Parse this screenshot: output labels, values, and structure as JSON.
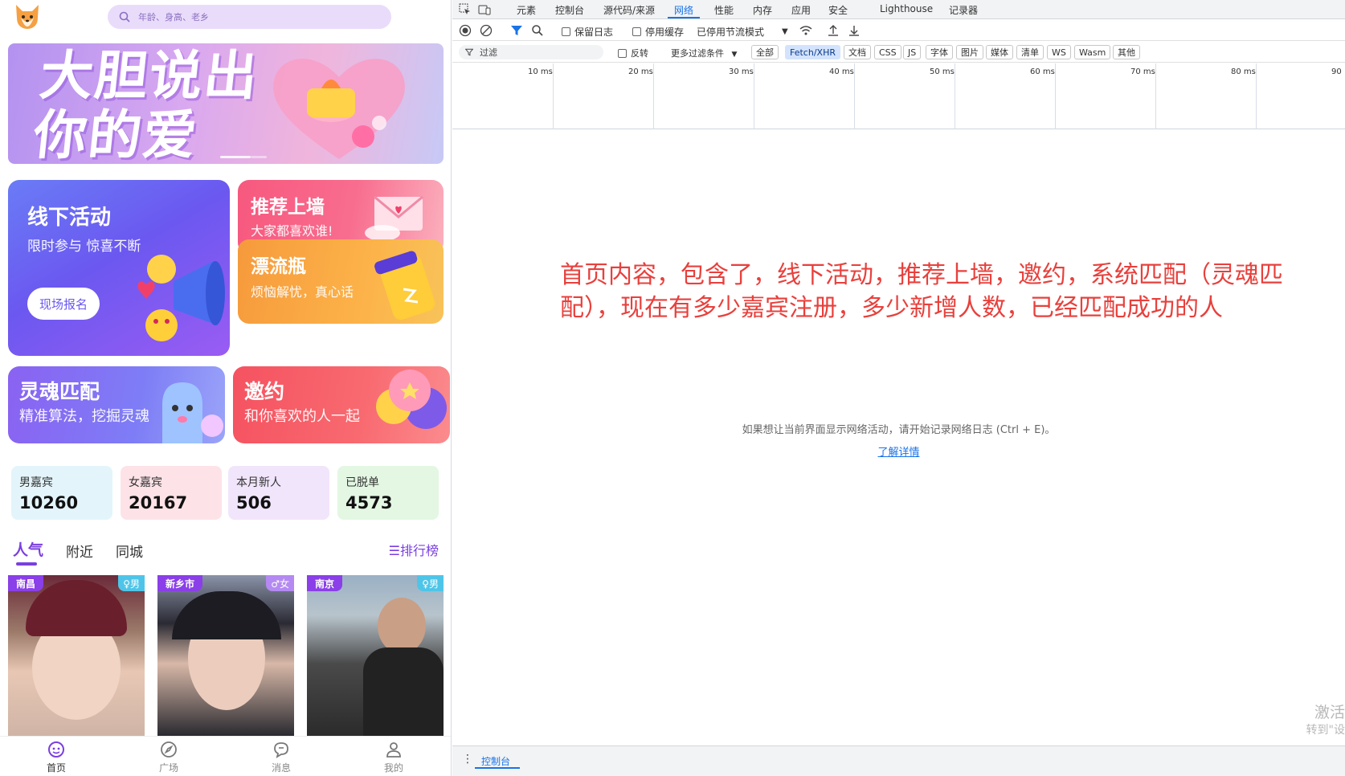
{
  "app": {
    "search_placeholder": "年龄、身高、老乡",
    "banner": {
      "line1": "大胆说出",
      "line2": "你的爱"
    },
    "cards": {
      "offline": {
        "title": "线下活动",
        "subtitle": "限时参与 惊喜不断",
        "button": "现场报名"
      },
      "recommend": {
        "title": "推荐上墙",
        "subtitle": "大家都喜欢谁!"
      },
      "bottle": {
        "title": "漂流瓶",
        "subtitle": "烦恼解忧，真心话"
      },
      "soul": {
        "title": "灵魂匹配",
        "subtitle": "精准算法，挖掘灵魂"
      },
      "invite": {
        "title": "邀约",
        "subtitle": "和你喜欢的人一起"
      }
    },
    "stats": [
      {
        "label": "男嘉宾",
        "value": "10260"
      },
      {
        "label": "女嘉宾",
        "value": "20167"
      },
      {
        "label": "本月新人",
        "value": "506"
      },
      {
        "label": "已脱单",
        "value": "4573"
      }
    ],
    "tabs": [
      "人气",
      "附近",
      "同城"
    ],
    "active_tab": "人气",
    "ranking": "☰排行榜",
    "profiles": [
      {
        "city": "南昌",
        "gender": "♀男"
      },
      {
        "city": "新乡市",
        "gender": "♂女"
      },
      {
        "city": "南京",
        "gender": "♀男"
      }
    ],
    "nav": [
      {
        "label": "首页",
        "icon": "home-icon"
      },
      {
        "label": "广场",
        "icon": "compass-icon"
      },
      {
        "label": "消息",
        "icon": "message-icon"
      },
      {
        "label": "我的",
        "icon": "user-icon"
      }
    ],
    "colors": {
      "accent": "#7a3fe0",
      "tag": "#8a3fe8"
    }
  },
  "devtools": {
    "tabs": [
      "元素",
      "控制台",
      "源代码/来源",
      "网络",
      "性能",
      "内存",
      "应用",
      "安全",
      "Lighthouse",
      "记录器"
    ],
    "active_tab": "网络",
    "toolbar": {
      "preserve_log": "保留日志",
      "disable_cache": "停用缓存",
      "throttle": "已停用节流模式"
    },
    "filter": {
      "placeholder": "过滤",
      "invert": "反转",
      "more_filters": "更多过滤条件",
      "types": [
        "全部",
        "Fetch/XHR",
        "文档",
        "CSS",
        "JS",
        "字体",
        "图片",
        "媒体",
        "清单",
        "WS",
        "Wasm",
        "其他"
      ],
      "active_type": "Fetch/XHR"
    },
    "timeline_ticks": [
      "10 ms",
      "20 ms",
      "30 ms",
      "40 ms",
      "50 ms",
      "60 ms",
      "70 ms",
      "80 ms",
      "90"
    ],
    "annotation": "首页内容，包含了，线下活动，推荐上墙，邀约，系统匹配（灵魂匹配），现在有多少嘉宾注册，多少新增人数，已经匹配成功的人",
    "empty_message": "如果想让当前界面显示网络活动，请开始记录网络日志 (Ctrl + E)。",
    "learn_more": "了解详情",
    "watermark_line1": "激活",
    "watermark_line2": "转到\"设",
    "drawer_tab": "控制台",
    "colors": {
      "link": "#1a73e8",
      "annotation": "#e8403c"
    }
  }
}
